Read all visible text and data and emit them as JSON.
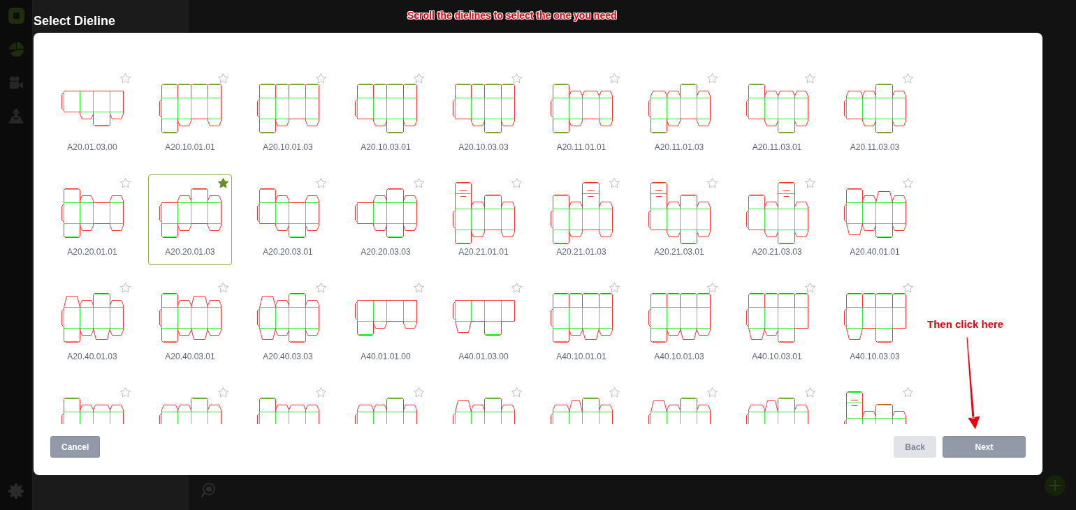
{
  "annotations": {
    "scroll_hint": "Scroll the dielines to select the one you need",
    "next_hint": "Then click here"
  },
  "dialog": {
    "title": "Select Dieline",
    "dielines": [
      {
        "label": "A20.01.03.00",
        "favorite": false,
        "selected": false
      },
      {
        "label": "A20.10.01.01",
        "favorite": false,
        "selected": false
      },
      {
        "label": "A20.10.01.03",
        "favorite": false,
        "selected": false
      },
      {
        "label": "A20.10.03.01",
        "favorite": false,
        "selected": false
      },
      {
        "label": "A20.10.03.03",
        "favorite": false,
        "selected": false
      },
      {
        "label": "A20.11.01.01",
        "favorite": false,
        "selected": false
      },
      {
        "label": "A20.11.01.03",
        "favorite": false,
        "selected": false
      },
      {
        "label": "A20.11.03.01",
        "favorite": false,
        "selected": false
      },
      {
        "label": "A20.11.03.03",
        "favorite": false,
        "selected": false
      },
      {
        "label": "A20.20.01.01",
        "favorite": false,
        "selected": false
      },
      {
        "label": "A20.20.01.03",
        "favorite": true,
        "selected": true
      },
      {
        "label": "A20.20.03.01",
        "favorite": false,
        "selected": false
      },
      {
        "label": "A20.20.03.03",
        "favorite": false,
        "selected": false
      },
      {
        "label": "A20.21.01.01",
        "favorite": false,
        "selected": false
      },
      {
        "label": "A20.21.01.03",
        "favorite": false,
        "selected": false
      },
      {
        "label": "A20.21.03.01",
        "favorite": false,
        "selected": false
      },
      {
        "label": "A20.21.03.03",
        "favorite": false,
        "selected": false
      },
      {
        "label": "A20.40.01.01",
        "favorite": false,
        "selected": false
      },
      {
        "label": "A20.40.01.03",
        "favorite": false,
        "selected": false
      },
      {
        "label": "A20.40.03.01",
        "favorite": false,
        "selected": false
      },
      {
        "label": "A20.40.03.03",
        "favorite": false,
        "selected": false
      },
      {
        "label": "A40.01.01.00",
        "favorite": false,
        "selected": false
      },
      {
        "label": "A40.01.03.00",
        "favorite": false,
        "selected": false
      },
      {
        "label": "A40.10.01.01",
        "favorite": false,
        "selected": false
      },
      {
        "label": "A40.10.01.03",
        "favorite": false,
        "selected": false
      },
      {
        "label": "A40.10.03.01",
        "favorite": false,
        "selected": false
      },
      {
        "label": "A40.10.03.03",
        "favorite": false,
        "selected": false
      },
      {
        "favorite": false,
        "selected": false
      },
      {
        "favorite": false,
        "selected": false
      },
      {
        "favorite": false,
        "selected": false
      },
      {
        "favorite": false,
        "selected": false
      },
      {
        "favorite": false,
        "selected": false
      },
      {
        "favorite": false,
        "selected": false
      },
      {
        "favorite": false,
        "selected": false
      },
      {
        "favorite": false,
        "selected": false
      },
      {
        "favorite": false,
        "selected": false
      }
    ],
    "left_buttons": [
      {
        "kind": "cancel",
        "label": "Cancel",
        "disabled": false
      }
    ],
    "right_buttons": [
      {
        "kind": "back",
        "label": "Back",
        "disabled": true
      },
      {
        "kind": "next",
        "label": "Next",
        "disabled": false
      }
    ]
  }
}
